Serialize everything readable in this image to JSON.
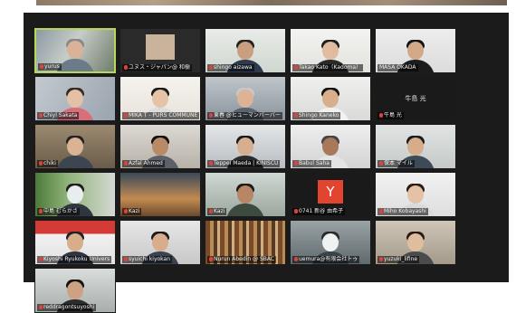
{
  "participants": [
    {
      "name": "yurus",
      "active": true
    },
    {
      "name": "ユヌス・ジャパン@ 和樹"
    },
    {
      "name": "shingo aizawa"
    },
    {
      "name": "Takao Kato（Kadoma）"
    },
    {
      "name": "MASA OKADA"
    },
    {
      "name": "Chiyl Sakata"
    },
    {
      "name": "MIKA T - PURS COMMUNE"
    },
    {
      "name": "東春 @ヒューマンバーバー"
    },
    {
      "name": "Shingo Kaneko"
    },
    {
      "name": "牛島 光",
      "big_label": "牛島 光"
    },
    {
      "name": "chiki"
    },
    {
      "name": "Azfal Ahmed"
    },
    {
      "name": "Teppei Maeda | KINISCU"
    },
    {
      "name": "Babul Saha"
    },
    {
      "name": "保本 マイル"
    },
    {
      "name": "中島 むらかさ"
    },
    {
      "name": "Kazi"
    },
    {
      "name": "0741 新谷 由希子"
    },
    {
      "name": "Miho Kobayashi"
    },
    {
      "name": "Kiyoshi Ryukoku Univers"
    },
    {
      "name": "syuichi kiyokan"
    },
    {
      "name": "Nurun Abedin @ SBAC"
    },
    {
      "name": "uemura@有限会社トゥ"
    },
    {
      "name": "yuzuki_lifine"
    },
    {
      "name": "reddragontsuyoshi"
    }
  ],
  "avatar_letter": "Y",
  "colors": {
    "window_bg": "#1b1b1b",
    "active_speaker": "#b6d75a",
    "mic_muted": "#e0413a",
    "avatar_bg": "#e2452f"
  }
}
